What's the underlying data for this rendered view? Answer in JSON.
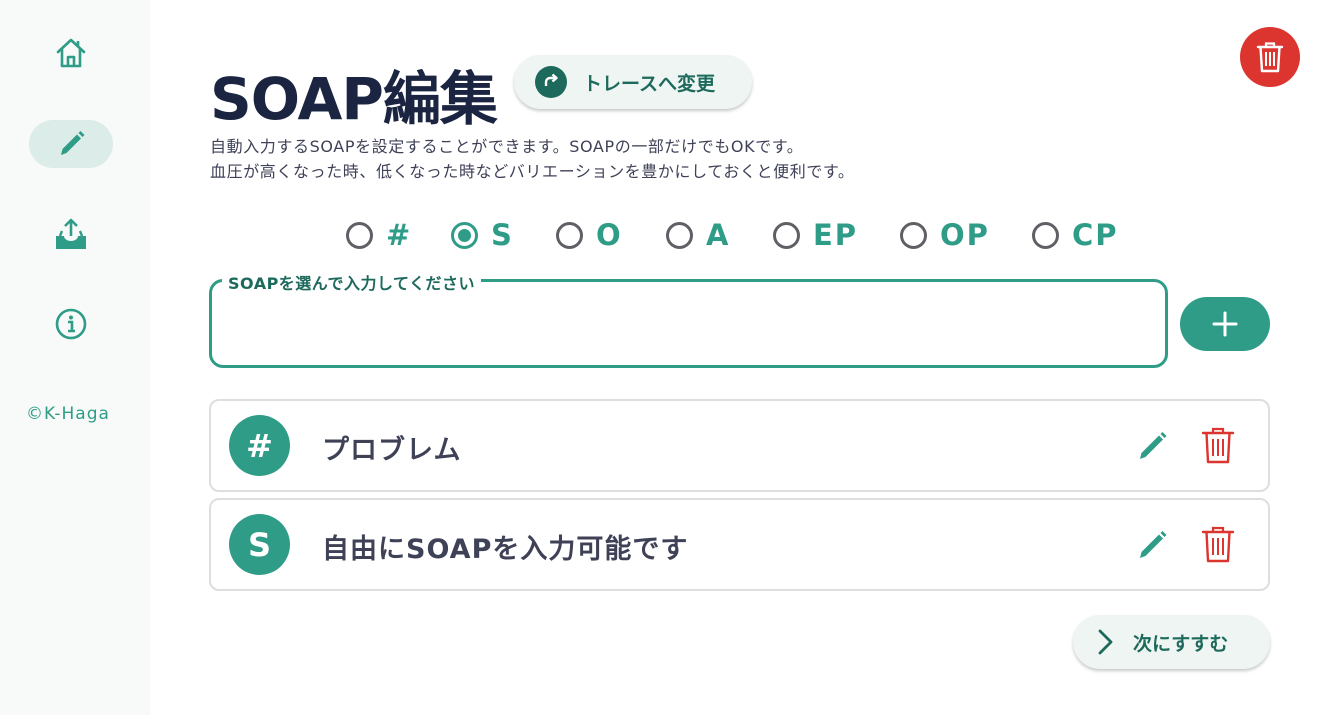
{
  "sidebar": {
    "items": [
      {
        "icon": "home-icon",
        "active": false
      },
      {
        "icon": "pencil-icon",
        "active": true
      },
      {
        "icon": "upload-icon",
        "active": false
      },
      {
        "icon": "info-icon",
        "active": false
      }
    ],
    "copyright": "©K-Haga"
  },
  "header": {
    "title": "SOAP編集",
    "trace_button_label": "トレースへ変更",
    "description_line1": "自動入力するSOAPを設定することができます。SOAPの一部だけでもOKです。",
    "description_line2": "血圧が高くなった時、低くなった時などバリエーションを豊かにしておくと便利です。"
  },
  "soap_types": {
    "options": [
      "#",
      "S",
      "O",
      "A",
      "EP",
      "OP",
      "CP"
    ],
    "selected": "S"
  },
  "input": {
    "label": "SOAPを選んで入力してください",
    "value": ""
  },
  "entries": [
    {
      "badge": "#",
      "text": "プロブレム"
    },
    {
      "badge": "S",
      "text": "自由にSOAPを入力可能です"
    }
  ],
  "footer": {
    "next_label": "次にすすむ"
  },
  "colors": {
    "accent": "#2f9c88",
    "accent_dark": "#1d6a5c",
    "danger": "#dc3530",
    "title": "#1b2440",
    "sidebar_bg": "#f7faf8"
  }
}
